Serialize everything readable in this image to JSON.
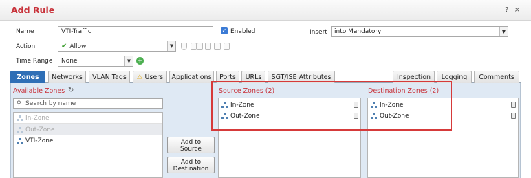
{
  "dialog": {
    "title": "Add Rule",
    "help_icon": "?",
    "close_icon": "×"
  },
  "form": {
    "name_label": "Name",
    "name_value": "VTI-Traffic",
    "enabled_label": "Enabled",
    "enabled_checked": true,
    "insert_label": "Insert",
    "insert_value": "into Mandatory",
    "action_label": "Action",
    "action_value": "Allow",
    "time_range_label": "Time Range",
    "time_range_value": "None"
  },
  "tabs": [
    {
      "label": "Zones",
      "active": true
    },
    {
      "label": "Networks"
    },
    {
      "label": "VLAN Tags"
    },
    {
      "label": "Users",
      "warning": true
    },
    {
      "label": "Applications"
    },
    {
      "label": "Ports"
    },
    {
      "label": "URLs"
    },
    {
      "label": "SGT/ISE Attributes"
    },
    {
      "label": "Inspection"
    },
    {
      "label": "Logging"
    },
    {
      "label": "Comments"
    }
  ],
  "available_zones": {
    "title": "Available Zones",
    "search_placeholder": "Search by name",
    "items": [
      {
        "label": "In-Zone",
        "dimmed": true
      },
      {
        "label": "Out-Zone",
        "dimmed": true
      },
      {
        "label": "VTI-Zone"
      }
    ]
  },
  "buttons": {
    "add_to_source": "Add to\nSource",
    "add_to_destination": "Add to\nDestination"
  },
  "source_zones": {
    "title": "Source Zones (2)",
    "items": [
      "In-Zone",
      "Out-Zone"
    ]
  },
  "destination_zones": {
    "title": "Destination Zones (2)",
    "items": [
      "In-Zone",
      "Out-Zone"
    ]
  },
  "colors": {
    "accent_red": "#c8323a",
    "tab_active": "#2f6fb6",
    "highlight_box": "#d63a3a",
    "panel_bg": "#dfe9f4"
  }
}
